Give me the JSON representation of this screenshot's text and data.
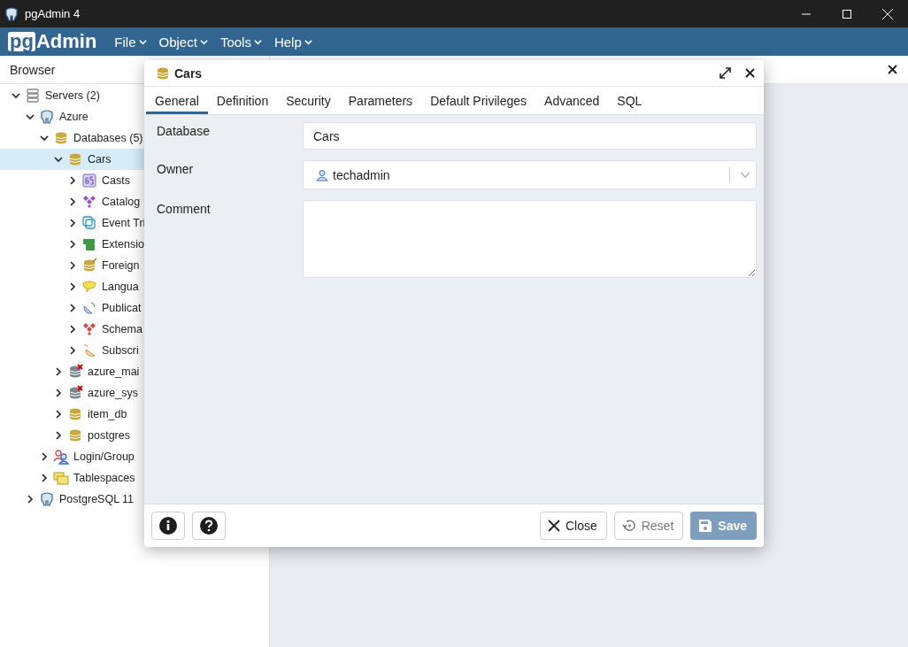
{
  "window": {
    "title": "pgAdmin 4"
  },
  "menu": {
    "logo": {
      "box": "pg",
      "rest": "Admin"
    },
    "items": [
      "File",
      "Object",
      "Tools",
      "Help"
    ]
  },
  "browser": {
    "title": "Browser",
    "tree": [
      {
        "label": "Servers (2)",
        "kind": "servers",
        "expanded": true,
        "selected": false,
        "children": [
          {
            "label": "Azure",
            "kind": "server",
            "expanded": true,
            "selected": false,
            "children": [
              {
                "label": "Databases (5)",
                "kind": "database",
                "expanded": true,
                "selected": false,
                "children": [
                  {
                    "label": "Cars",
                    "kind": "database",
                    "expanded": true,
                    "selected": true,
                    "children": [
                      {
                        "label": "Casts",
                        "kind": "casts",
                        "expanded": false,
                        "selected": false
                      },
                      {
                        "label": "Catalog",
                        "kind": "catalogs",
                        "expanded": false,
                        "selected": false
                      },
                      {
                        "label": "Event Tri",
                        "kind": "event",
                        "expanded": false,
                        "selected": false
                      },
                      {
                        "label": "Extensio",
                        "kind": "extension",
                        "expanded": false,
                        "selected": false
                      },
                      {
                        "label": "Foreign",
                        "kind": "foreign",
                        "expanded": false,
                        "selected": false
                      },
                      {
                        "label": "Langua",
                        "kind": "language",
                        "expanded": false,
                        "selected": false
                      },
                      {
                        "label": "Publicat",
                        "kind": "publication",
                        "expanded": false,
                        "selected": false
                      },
                      {
                        "label": "Schema",
                        "kind": "schemas",
                        "expanded": false,
                        "selected": false
                      },
                      {
                        "label": "Subscri",
                        "kind": "subscription",
                        "expanded": false,
                        "selected": false
                      }
                    ]
                  },
                  {
                    "label": "azure_mai",
                    "kind": "database-down",
                    "expanded": false,
                    "selected": false
                  },
                  {
                    "label": "azure_sys",
                    "kind": "database-down",
                    "expanded": false,
                    "selected": false
                  },
                  {
                    "label": "item_db",
                    "kind": "database",
                    "expanded": false,
                    "selected": false
                  },
                  {
                    "label": "postgres",
                    "kind": "database",
                    "expanded": false,
                    "selected": false
                  }
                ]
              },
              {
                "label": "Login/Group",
                "kind": "roles",
                "expanded": false,
                "selected": false
              },
              {
                "label": "Tablespaces",
                "kind": "tablespaces",
                "expanded": false,
                "selected": false
              }
            ]
          },
          {
            "label": "PostgreSQL 11",
            "kind": "server",
            "expanded": false,
            "selected": false
          }
        ]
      }
    ]
  },
  "dialog": {
    "title": "Cars",
    "tabs": [
      {
        "label": "General",
        "selected": true
      },
      {
        "label": "Definition",
        "selected": false
      },
      {
        "label": "Security",
        "selected": false
      },
      {
        "label": "Parameters",
        "selected": false
      },
      {
        "label": "Default Privileges",
        "selected": false
      },
      {
        "label": "Advanced",
        "selected": false
      },
      {
        "label": "SQL",
        "selected": false
      }
    ],
    "fields": [
      {
        "kind": "text",
        "label": "Database",
        "value": "Cars"
      },
      {
        "kind": "select",
        "label": "Owner",
        "value": "techadmin"
      },
      {
        "kind": "textarea",
        "label": "Comment"
      }
    ],
    "buttons": [
      {
        "kind": "close",
        "label": "Close",
        "disabled": false
      },
      {
        "kind": "reset",
        "label": "Reset",
        "disabled": true
      },
      {
        "kind": "save",
        "label": "Save",
        "disabled": true
      }
    ]
  }
}
